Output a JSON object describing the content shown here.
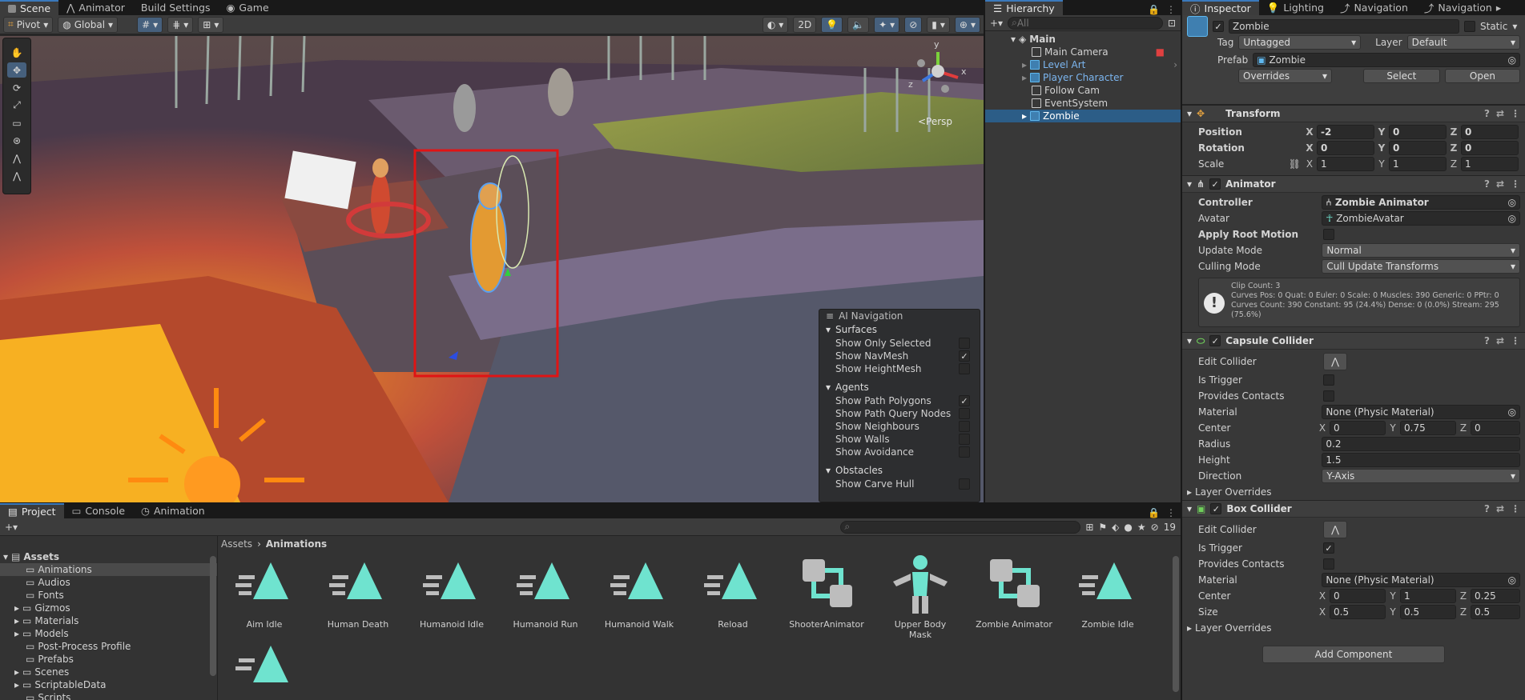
{
  "scene_tabs": [
    {
      "label": "Scene"
    },
    {
      "label": "Animator"
    },
    {
      "label": "Build Settings"
    },
    {
      "label": "Game"
    }
  ],
  "scene_toolbar": {
    "pivot": "Pivot",
    "space": "Global",
    "mode_2d": "2D"
  },
  "gizmo": {
    "view_label": "<Persp",
    "axis_y": "y",
    "axis_x": "x",
    "axis_z": "z"
  },
  "ai_navigation": {
    "title": "AI Navigation",
    "surfaces": {
      "title": "Surfaces",
      "items": [
        {
          "label": "Show Only Selected",
          "checked": false
        },
        {
          "label": "Show NavMesh",
          "checked": true
        },
        {
          "label": "Show HeightMesh",
          "checked": false
        }
      ]
    },
    "agents": {
      "title": "Agents",
      "items": [
        {
          "label": "Show Path Polygons",
          "checked": true
        },
        {
          "label": "Show Path Query Nodes",
          "checked": false
        },
        {
          "label": "Show Neighbours",
          "checked": false
        },
        {
          "label": "Show Walls",
          "checked": false
        },
        {
          "label": "Show Avoidance",
          "checked": false
        }
      ]
    },
    "obstacles": {
      "title": "Obstacles",
      "items": [
        {
          "label": "Show Carve Hull",
          "checked": false
        }
      ]
    }
  },
  "hierarchy": {
    "tab": "Hierarchy",
    "search_placeholder": "All",
    "root": "Main",
    "items": [
      {
        "label": "Main Camera",
        "prefab": false,
        "expandable": false,
        "selected": false
      },
      {
        "label": "Level Art",
        "prefab": true,
        "expandable": true,
        "selected": false
      },
      {
        "label": "Player Character",
        "prefab": true,
        "expandable": true,
        "selected": false
      },
      {
        "label": "Follow Cam",
        "prefab": false,
        "expandable": false,
        "selected": false
      },
      {
        "label": "EventSystem",
        "prefab": false,
        "expandable": false,
        "selected": false
      },
      {
        "label": "Zombie",
        "prefab": true,
        "expandable": true,
        "selected": true
      }
    ]
  },
  "inspector_tabs": [
    {
      "label": "Inspector"
    },
    {
      "label": "Lighting"
    },
    {
      "label": "Navigation"
    },
    {
      "label": "Navigation"
    }
  ],
  "inspector": {
    "object_name": "Zombie",
    "static_label": "Static",
    "tag_label": "Tag",
    "tag_value": "Untagged",
    "layer_label": "Layer",
    "layer_value": "Default",
    "prefab_label": "Prefab",
    "prefab_value": "Zombie",
    "overrides": "Overrides",
    "select": "Select",
    "open": "Open",
    "transform": {
      "title": "Transform",
      "position": {
        "label": "Position",
        "x": "-2",
        "y": "0",
        "z": "0"
      },
      "rotation": {
        "label": "Rotation",
        "x": "0",
        "y": "0",
        "z": "0"
      },
      "scale": {
        "label": "Scale",
        "x": "1",
        "y": "1",
        "z": "1"
      }
    },
    "animator": {
      "title": "Animator",
      "controller_label": "Controller",
      "controller_value": "Zombie Animator",
      "avatar_label": "Avatar",
      "avatar_value": "ZombieAvatar",
      "root_motion_label": "Apply Root Motion",
      "update_mode_label": "Update Mode",
      "update_mode_value": "Normal",
      "culling_mode_label": "Culling Mode",
      "culling_mode_value": "Cull Update Transforms",
      "info_line1": "Clip Count: 3",
      "info_line2": "Curves Pos: 0 Quat: 0 Euler: 0 Scale: 0 Muscles: 390 Generic: 0 PPtr: 0",
      "info_line3": "Curves Count: 390 Constant: 95 (24.4%) Dense: 0 (0.0%) Stream: 295",
      "info_line4": "(75.6%)"
    },
    "capsule": {
      "title": "Capsule Collider",
      "edit_label": "Edit Collider",
      "trigger_label": "Is Trigger",
      "contacts_label": "Provides Contacts",
      "material_label": "Material",
      "material_value": "None (Physic Material)",
      "center_label": "Center",
      "cx": "0",
      "cy": "0.75",
      "cz": "0",
      "radius_label": "Radius",
      "radius_value": "0.2",
      "height_label": "Height",
      "height_value": "1.5",
      "direction_label": "Direction",
      "direction_value": "Y-Axis",
      "layer_overrides": "Layer Overrides"
    },
    "box": {
      "title": "Box Collider",
      "edit_label": "Edit Collider",
      "trigger_label": "Is Trigger",
      "contacts_label": "Provides Contacts",
      "material_label": "Material",
      "material_value": "None (Physic Material)",
      "center_label": "Center",
      "cx": "0",
      "cy": "1",
      "cz": "0.25",
      "size_label": "Size",
      "sx": "0.5",
      "sy": "0.5",
      "sz": "0.5",
      "layer_overrides": "Layer Overrides"
    },
    "add_component": "Add Component"
  },
  "bottom_tabs": [
    {
      "label": "Project"
    },
    {
      "label": "Console"
    },
    {
      "label": "Animation"
    }
  ],
  "project": {
    "hidden_count": "19",
    "tree_root": "Assets",
    "tree": [
      {
        "label": "Animations",
        "selected": true,
        "expandable": false
      },
      {
        "label": "Audios",
        "selected": false,
        "expandable": false
      },
      {
        "label": "Fonts",
        "selected": false,
        "expandable": false
      },
      {
        "label": "Gizmos",
        "selected": false,
        "expandable": true
      },
      {
        "label": "Materials",
        "selected": false,
        "expandable": true
      },
      {
        "label": "Models",
        "selected": false,
        "expandable": true
      },
      {
        "label": "Post-Process Profile",
        "selected": false,
        "expandable": false
      },
      {
        "label": "Prefabs",
        "selected": false,
        "expandable": false
      },
      {
        "label": "Scenes",
        "selected": false,
        "expandable": true
      },
      {
        "label": "ScriptableData",
        "selected": false,
        "expandable": true
      },
      {
        "label": "Scripts",
        "selected": false,
        "expandable": false
      }
    ],
    "breadcrumb": {
      "root": "Assets",
      "current": "Animations"
    },
    "assets": [
      {
        "label": "Aim Idle",
        "icon": "anim-clip-icon"
      },
      {
        "label": "Human Death",
        "icon": "anim-clip-icon"
      },
      {
        "label": "Humanoid Idle",
        "icon": "anim-clip-icon"
      },
      {
        "label": "Humanoid Run",
        "icon": "anim-clip-icon"
      },
      {
        "label": "Humanoid Walk",
        "icon": "anim-clip-icon"
      },
      {
        "label": "Reload",
        "icon": "anim-clip-icon"
      },
      {
        "label": "ShooterAnimator",
        "icon": "animator-controller-icon"
      },
      {
        "label": "Upper Body Mask",
        "icon": "avatar-mask-icon"
      },
      {
        "label": "Zombie Animator",
        "icon": "animator-controller-icon"
      },
      {
        "label": "Zombie Idle",
        "icon": "anim-clip-icon"
      }
    ]
  },
  "colors": {
    "accent": "#3a79bb",
    "asset_icon": "#6fe3cf",
    "selection_box": "#e01414"
  }
}
